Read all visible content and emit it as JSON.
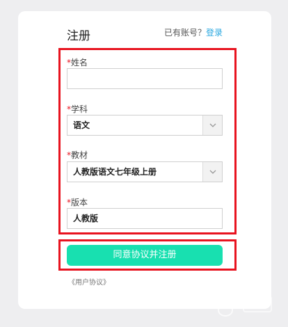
{
  "form": {
    "title": "注册",
    "has_account_text": "已有账号？",
    "login_link": "登录",
    "required_mark": "*",
    "fields": {
      "name": {
        "label": "姓名",
        "value": ""
      },
      "subject": {
        "label": "学科",
        "value": "语文"
      },
      "textbook": {
        "label": "教材",
        "value": "人教版语文七年级上册"
      },
      "edition": {
        "label": "版本",
        "value": "人教版"
      }
    },
    "submit_label": "同意协议并注册",
    "agreement_link": "《用户协议》"
  },
  "colors": {
    "accent": "#18e0b0",
    "link": "#2aa8e0",
    "required": "#e8131f",
    "highlight_frame": "#e8131f"
  }
}
